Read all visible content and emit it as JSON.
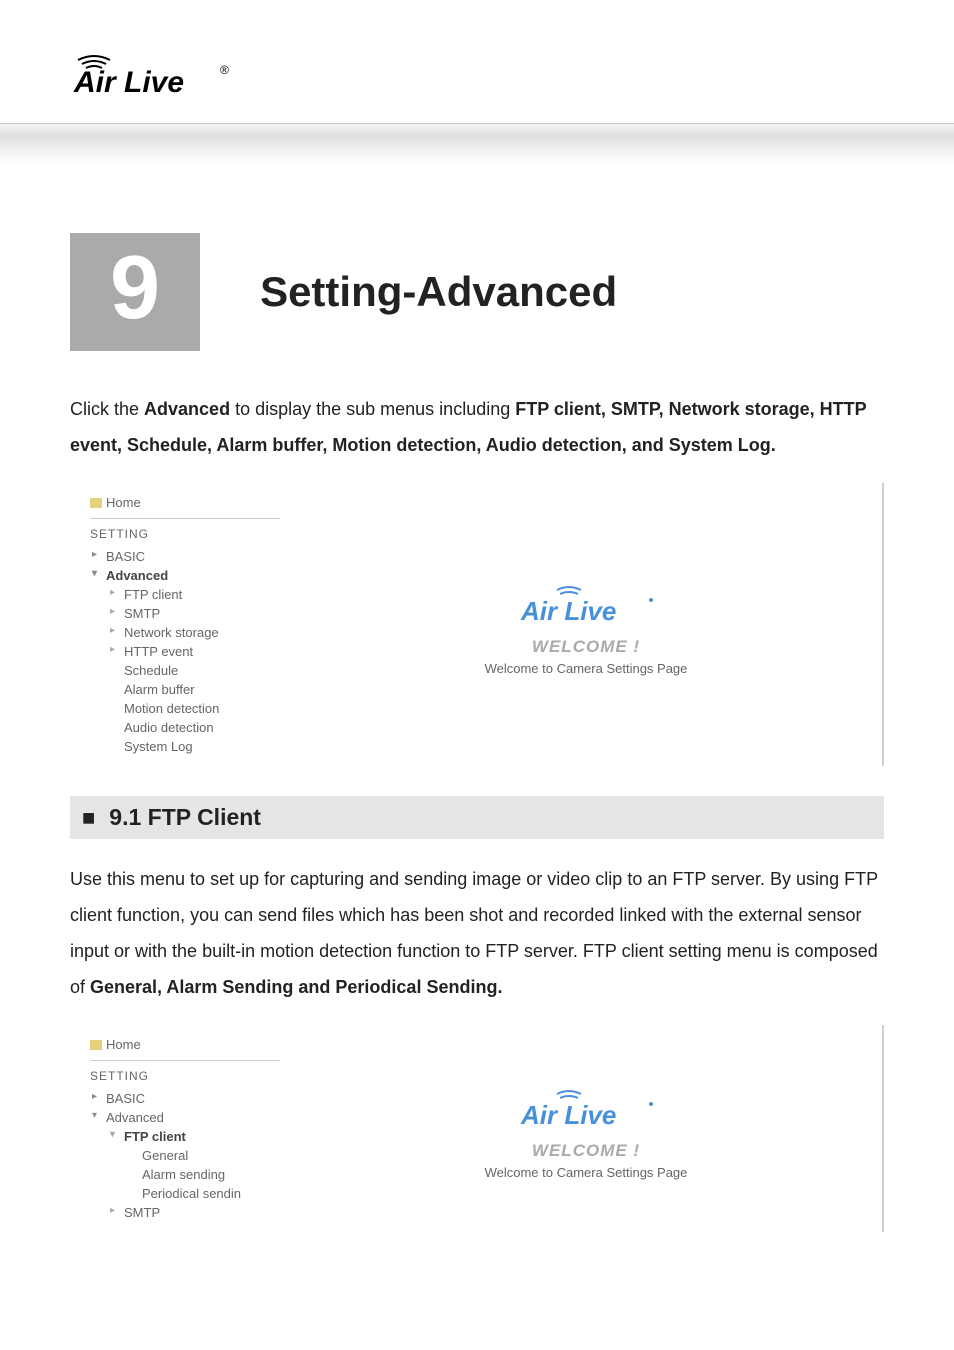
{
  "logo_text": "Air Live",
  "logo_reg": "®",
  "chapter": {
    "number": "9",
    "title": "Setting-Advanced"
  },
  "intro": {
    "pre": "Click the ",
    "b1": "Advanced",
    "mid": " to display the sub menus including ",
    "b2": "FTP client, SMTP, Network storage, HTTP event, Schedule, Alarm buffer, Motion detection, Audio detection, and System Log."
  },
  "nav1": {
    "home": "Home",
    "heading": "SETTING",
    "items": [
      {
        "label": "BASIC",
        "level": 1
      },
      {
        "label": "Advanced",
        "level": 1,
        "open": true,
        "active": true
      },
      {
        "label": "FTP client",
        "level": 2
      },
      {
        "label": "SMTP",
        "level": 2
      },
      {
        "label": "Network storage",
        "level": 2
      },
      {
        "label": "HTTP event",
        "level": 2
      },
      {
        "label": "Schedule",
        "level": 2,
        "noarrow": true
      },
      {
        "label": "Alarm buffer",
        "level": 2,
        "noarrow": true
      },
      {
        "label": "Motion detection",
        "level": 2,
        "noarrow": true
      },
      {
        "label": "Audio detection",
        "level": 2,
        "noarrow": true
      },
      {
        "label": "System Log",
        "level": 2,
        "noarrow": true
      }
    ]
  },
  "panel": {
    "logo": "Air Live",
    "welcome": "WELCOME !",
    "subtitle": "Welcome to Camera Settings Page"
  },
  "section": {
    "number_title": "9.1 FTP Client"
  },
  "body": {
    "p1": "Use this menu to set up for capturing and sending image or video clip to an FTP server. By using FTP client function, you can send files which has been shot and recorded linked with the external sensor input or with the built-in motion detection function to FTP server. FTP client setting menu is composed of ",
    "p1_bold": "General, Alarm Sending and Periodical Sending."
  },
  "nav2": {
    "home": "Home",
    "heading": "SETTING",
    "items": [
      {
        "label": "BASIC",
        "level": 1
      },
      {
        "label": "Advanced",
        "level": 1,
        "open": true
      },
      {
        "label": "FTP client",
        "level": 2,
        "open": true,
        "active": true
      },
      {
        "label": "General",
        "level": 3
      },
      {
        "label": "Alarm sending",
        "level": 3
      },
      {
        "label": "Periodical sendin",
        "level": 3
      },
      {
        "label": "SMTP",
        "level": 2
      }
    ]
  }
}
